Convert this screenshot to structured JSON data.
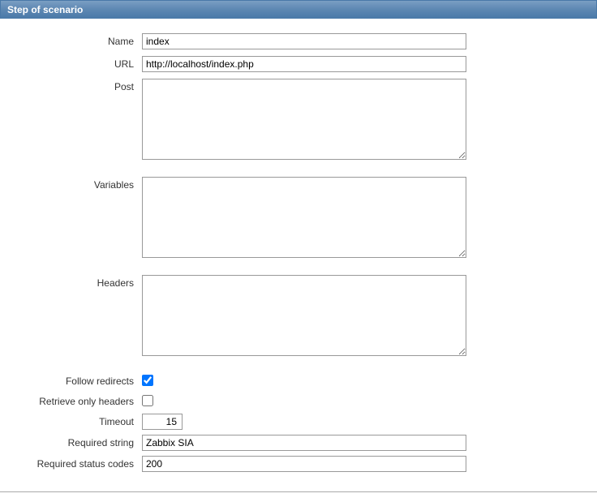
{
  "header": {
    "title": "Step of scenario"
  },
  "form": {
    "name": {
      "label": "Name",
      "value": "index"
    },
    "url": {
      "label": "URL",
      "value": "http://localhost/index.php"
    },
    "post": {
      "label": "Post",
      "value": ""
    },
    "variables": {
      "label": "Variables",
      "value": ""
    },
    "headers": {
      "label": "Headers",
      "value": ""
    },
    "follow_redirects": {
      "label": "Follow redirects",
      "checked": true
    },
    "retrieve_only_headers": {
      "label": "Retrieve only headers",
      "checked": false
    },
    "timeout": {
      "label": "Timeout",
      "value": "15"
    },
    "required_string": {
      "label": "Required string",
      "value": "Zabbix SIA"
    },
    "required_status_codes": {
      "label": "Required status codes",
      "value": "200"
    }
  }
}
